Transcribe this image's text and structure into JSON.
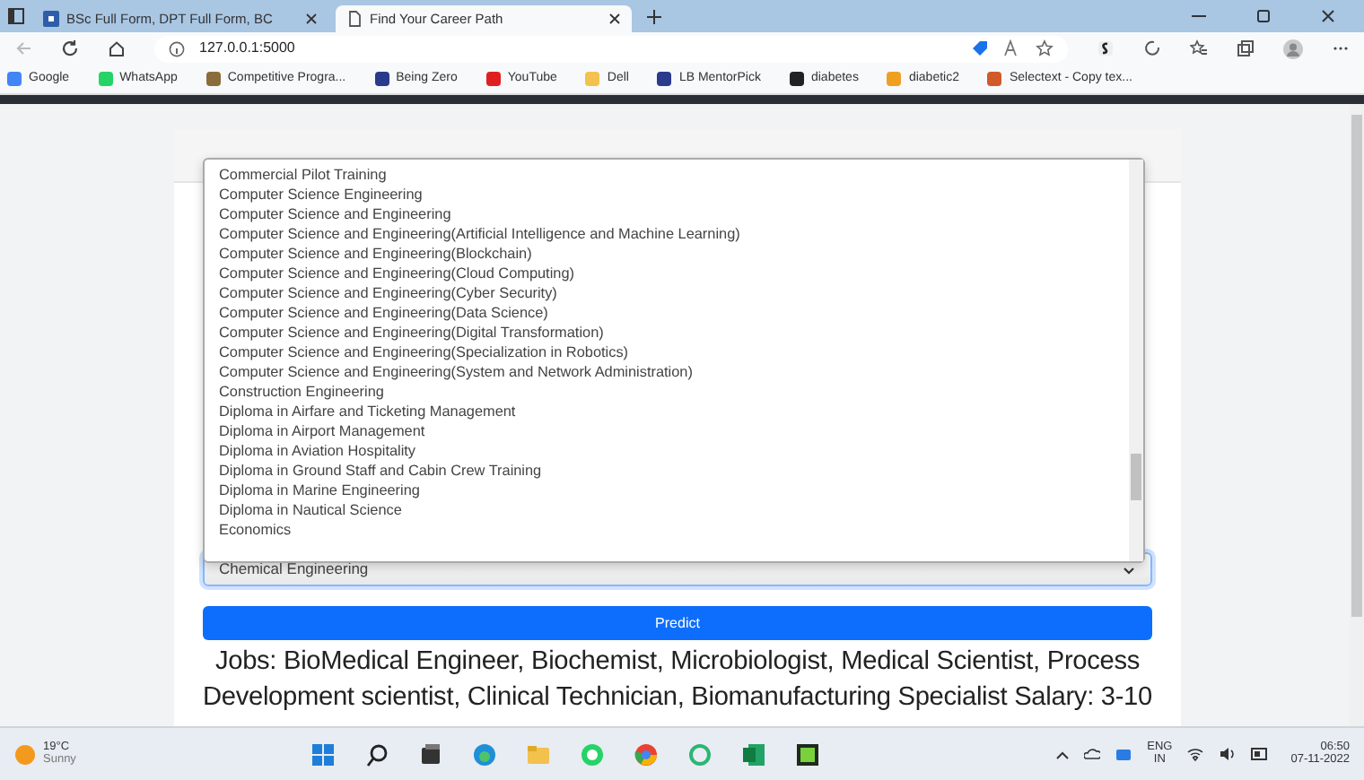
{
  "browser": {
    "tabs": [
      {
        "title": "BSc Full Form, DPT Full Form, BC",
        "selected": false
      },
      {
        "title": "Find Your Career Path",
        "selected": true
      }
    ],
    "address": "127.0.0.1:5000",
    "bookmarks": [
      {
        "label": "Google",
        "color": "#4285f4"
      },
      {
        "label": "WhatsApp",
        "color": "#25d366"
      },
      {
        "label": "Competitive Progra...",
        "color": "#8a6d3b"
      },
      {
        "label": "Being Zero",
        "color": "#2a3a8c"
      },
      {
        "label": "YouTube",
        "color": "#e02020"
      },
      {
        "label": "Dell",
        "color": "#f2c14e"
      },
      {
        "label": "LB MentorPick",
        "color": "#2a3a8c"
      },
      {
        "label": "diabetes",
        "color": "#222222"
      },
      {
        "label": "diabetic2",
        "color": "#f0a020"
      },
      {
        "label": "Selectext - Copy tex...",
        "color": "#d05a2a"
      }
    ]
  },
  "form": {
    "options": [
      "Commercial Pilot Training",
      "Computer Science Engineering",
      "Computer Science and Engineering",
      "Computer Science and Engineering(Artificial Intelligence and Machine Learning)",
      "Computer Science and Engineering(Blockchain)",
      "Computer Science and Engineering(Cloud Computing)",
      "Computer Science and Engineering(Cyber Security)",
      "Computer Science and Engineering(Data Science)",
      "Computer Science and Engineering(Digital Transformation)",
      "Computer Science and Engineering(Specialization in Robotics)",
      "Computer Science and Engineering(System and Network Administration)",
      "Construction Engineering",
      "Diploma in Airfare and Ticketing Management",
      "Diploma in Airport Management",
      "Diploma in Aviation Hospitality",
      "Diploma in Ground Staff and Cabin Crew Training",
      "Diploma in Marine Engineering",
      "Diploma in Nautical Science",
      "Economics"
    ],
    "selected_value": "Chemical Engineering",
    "button": "Predict",
    "result": "Jobs: BioMedical Engineer, Biochemist, Microbiologist, Medical Scientist, Process Development scientist, Clinical Technician, Biomanufacturing Specialist Salary: 3-10"
  },
  "taskbar": {
    "temperature": "19°C",
    "weather": "Sunny",
    "language": "ENG",
    "region": "IN",
    "time": "06:50",
    "date": "07-11-2022"
  }
}
